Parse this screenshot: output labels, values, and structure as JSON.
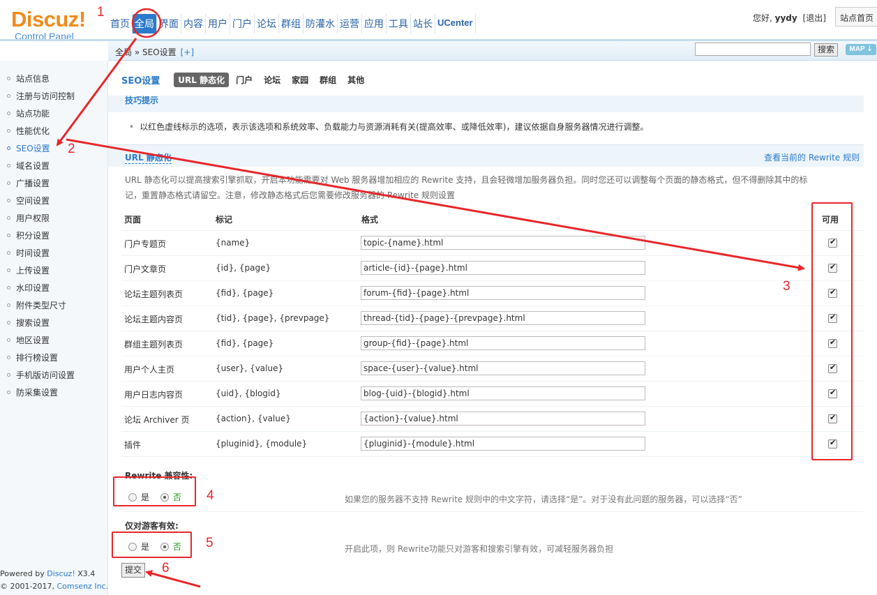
{
  "logo": {
    "main": "Discuz!",
    "sub": "Control Panel"
  },
  "topnav": [
    {
      "label": "首页",
      "active": false
    },
    {
      "label": "全局",
      "active": true
    },
    {
      "label": "界面",
      "active": false
    },
    {
      "label": "内容",
      "active": false
    },
    {
      "label": "用户",
      "active": false
    },
    {
      "label": "门户",
      "active": false
    },
    {
      "label": "论坛",
      "active": false
    },
    {
      "label": "群组",
      "active": false
    },
    {
      "label": "防灌水",
      "active": false
    },
    {
      "label": "运营",
      "active": false
    },
    {
      "label": "应用",
      "active": false
    },
    {
      "label": "工具",
      "active": false
    },
    {
      "label": "站长",
      "active": false
    },
    {
      "label": "UCenter",
      "active": false
    }
  ],
  "userbar": {
    "greeting": "您好, ",
    "username": "yydy",
    "logout": "[退出]",
    "site_home": "站点首页"
  },
  "subbar": {
    "breadcrumb": "全局 » SEO设置",
    "plus": "[+]",
    "search_button": "搜索",
    "map_button": "MAP ⇣"
  },
  "sidebar": {
    "items": [
      "站点信息",
      "注册与访问控制",
      "站点功能",
      "性能优化",
      "SEO设置",
      "域名设置",
      "广播设置",
      "空间设置",
      "用户权限",
      "积分设置",
      "时间设置",
      "上传设置",
      "水印设置",
      "附件类型尺寸",
      "搜索设置",
      "地区设置",
      "排行榜设置",
      "手机版访问设置",
      "防采集设置"
    ],
    "active_index": 4,
    "powered_by": "Powered by ",
    "powered_link": "Discuz!",
    "powered_version": " X3.4",
    "copyright": "© 2001-2017, ",
    "copyright_link": "Comsenz Inc."
  },
  "main": {
    "page_title": "SEO设置",
    "tabs": [
      "URL 静态化",
      "门户",
      "论坛",
      "家园",
      "群组",
      "其他"
    ],
    "active_tab": 0,
    "tip_head": "技巧提示",
    "tip_text": "以红色虚线标示的选项，表示该选项和系统效率、负载能力与资源消耗有关(提高效率、或降低效率)，建议依据自身服务器情况进行调整。",
    "section_title": "URL 静态化",
    "section_link": "查看当前的 Rewrite 规则",
    "description": "URL 静态化可以提高搜索引擎抓取，开启本功能需要对 Web 服务器增加相应的 Rewrite 支持，且会轻微增加服务器负担。同时您还可以调整每个页面的静态格式，但不得删除其中的标记，重置静态格式请留空。注意，修改静态格式后您需要修改服务器的 Rewrite 规则设置",
    "columns": {
      "page": "页面",
      "mark": "标记",
      "format": "格式",
      "enabled": "可用"
    },
    "rules": [
      {
        "page": "门户专题页",
        "mark": "{name}",
        "format": "topic-{name}.html",
        "enabled": true
      },
      {
        "page": "门户文章页",
        "mark": "{id}, {page}",
        "format": "article-{id}-{page}.html",
        "enabled": true
      },
      {
        "page": "论坛主题列表页",
        "mark": "{fid}, {page}",
        "format": "forum-{fid}-{page}.html",
        "enabled": true
      },
      {
        "page": "论坛主题内容页",
        "mark": "{tid}, {page}, {prevpage}",
        "format": "thread-{tid}-{page}-{prevpage}.html",
        "enabled": true
      },
      {
        "page": "群组主题列表页",
        "mark": "{fid}, {page}",
        "format": "group-{fid}-{page}.html",
        "enabled": true
      },
      {
        "page": "用户个人主页",
        "mark": "{user}, {value}",
        "format": "space-{user}-{value}.html",
        "enabled": true
      },
      {
        "page": "用户日志内容页",
        "mark": "{uid}, {blogid}",
        "format": "blog-{uid}-{blogid}.html",
        "enabled": true
      },
      {
        "page": "论坛 Archiver 页",
        "mark": "{action}, {value}",
        "format": "{action}-{value}.html",
        "enabled": true
      },
      {
        "page": "插件",
        "mark": "{pluginid}, {module}",
        "format": "{pluginid}-{module}.html",
        "enabled": true
      }
    ],
    "rewrite_compat": {
      "label": "Rewrite 兼容性:",
      "yes": "是",
      "no": "否",
      "selected": "no",
      "note": "如果您的服务器不支持 Rewrite 规则中的中文字符，请选择“是”。对于没有此问题的服务器，可以选择“否”"
    },
    "guest_only": {
      "label": "仅对游客有效:",
      "yes": "是",
      "no": "否",
      "selected": "no",
      "note": "开启此项，则 Rewrite功能只对游客和搜索引擎有效，可减轻服务器负担"
    },
    "submit": "提交"
  },
  "annotations": [
    "1",
    "2",
    "3",
    "4",
    "5",
    "6"
  ],
  "colors": {
    "accent": "#2b7acb",
    "annotation": "#e8262a",
    "logo": "#f08a1c",
    "selected_option": "#1a9c1a"
  }
}
